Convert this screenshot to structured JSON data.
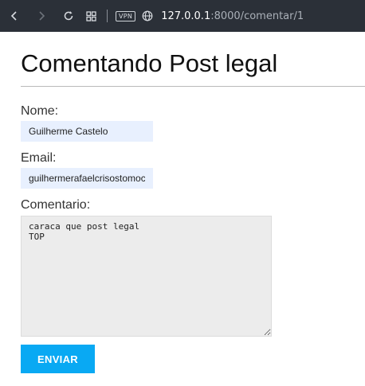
{
  "browser": {
    "vpn_label": "VPN",
    "url_host": "127.0.0.1",
    "url_path": ":8000/comentar/1"
  },
  "page": {
    "title": "Comentando Post legal"
  },
  "form": {
    "nome_label": "Nome:",
    "nome_value": "Guilherme Castelo",
    "email_label": "Email:",
    "email_value": "guilhermerafaelcrisostomoc",
    "comentario_label": "Comentario:",
    "comentario_value": "caraca que post legal\nTOP",
    "submit_label": "ENVIAR"
  },
  "colors": {
    "browser_bar": "#2b3038",
    "input_autofill": "#e8f0fe",
    "textarea_bg": "#ececec",
    "submit_button": "#09a9f3"
  }
}
